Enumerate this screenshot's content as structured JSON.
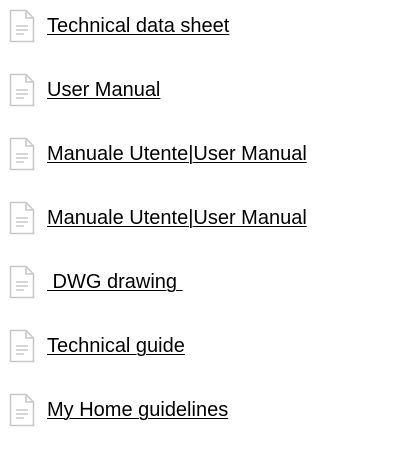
{
  "documents": [
    {
      "label": "Technical data sheet",
      "icon": "document-icon"
    },
    {
      "label": "User Manual",
      "icon": "document-icon"
    },
    {
      "label": "Manuale Utente|User Manual",
      "icon": "document-icon"
    },
    {
      "label": "Manuale Utente|User Manual",
      "icon": "document-icon"
    },
    {
      "label": " DWG drawing ",
      "icon": "document-icon"
    },
    {
      "label": "Technical guide",
      "icon": "document-icon"
    },
    {
      "label": "My Home guidelines",
      "icon": "document-icon"
    }
  ],
  "colors": {
    "icon_stroke": "#c8c8c8",
    "icon_fill": "#ffffff",
    "link_text": "#000000"
  }
}
